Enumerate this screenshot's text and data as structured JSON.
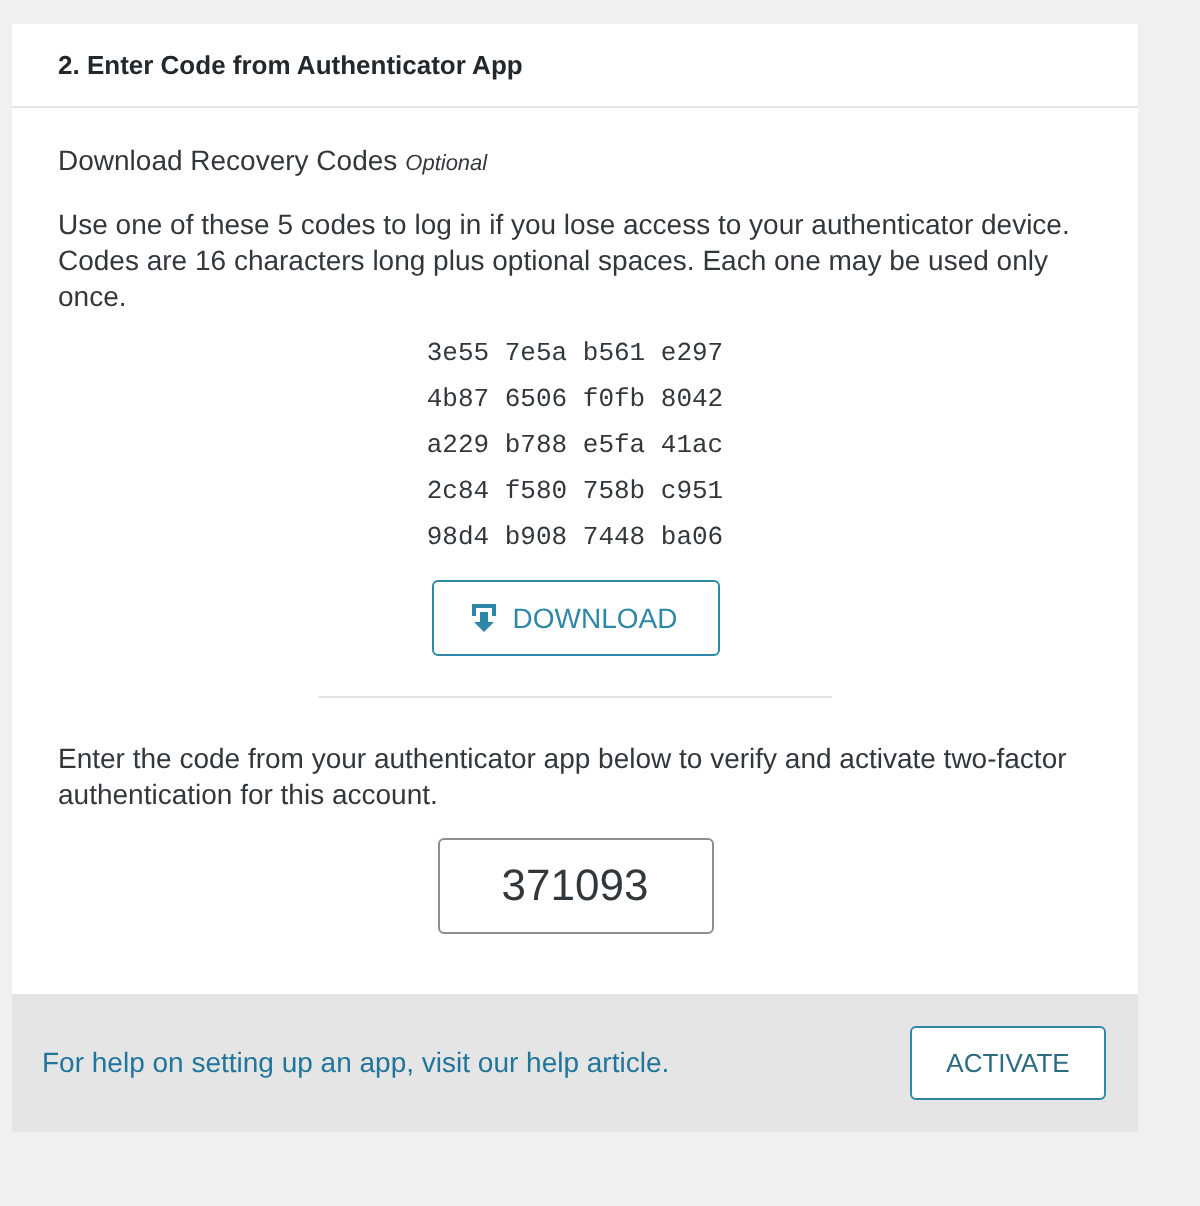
{
  "card": {
    "title": "2. Enter Code from Authenticator App"
  },
  "recovery": {
    "heading": "Download Recovery Codes",
    "optional_label": "Optional",
    "description": "Use one of these 5 codes to log in if you lose access to your authenticator device. Codes are 16 characters long plus optional spaces. Each one may be used only once.",
    "codes": [
      "3e55 7e5a b561 e297",
      "4b87 6506 f0fb 8042",
      "a229 b788 e5fa 41ac",
      "2c84 f580 758b c951",
      "98d4 b908 7448 ba06"
    ],
    "download_button": "DOWNLOAD"
  },
  "verify": {
    "instructions": "Enter the code from your authenticator app below to verify and activate two-factor authentication for this account.",
    "code_value": "371093"
  },
  "footer": {
    "help_link": "For help on setting up an app, visit our help article.",
    "activate_button": "ACTIVATE"
  }
}
